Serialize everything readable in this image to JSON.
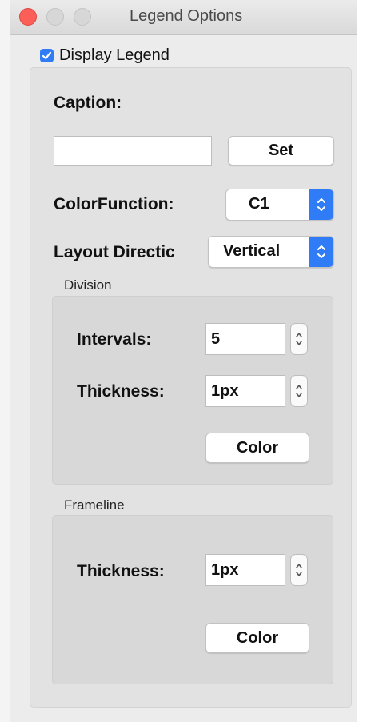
{
  "window": {
    "title": "Legend Options"
  },
  "display_legend": {
    "label": "Display Legend",
    "checked": true
  },
  "caption": {
    "label": "Caption:",
    "value": "",
    "set_label": "Set"
  },
  "color_function": {
    "label": "ColorFunction:",
    "value": "C1"
  },
  "layout_direction": {
    "label": "Layout Directic",
    "value": "Vertical"
  },
  "division": {
    "title": "Division",
    "intervals_label": "Intervals:",
    "intervals_value": "5",
    "thickness_label": "Thickness:",
    "thickness_value": "1px",
    "color_label": "Color"
  },
  "frameline": {
    "title": "Frameline",
    "thickness_label": "Thickness:",
    "thickness_value": "1px",
    "color_label": "Color"
  },
  "colors": {
    "accent": "#2f7cf6",
    "close": "#fc5f57",
    "panel": "#ececec"
  }
}
